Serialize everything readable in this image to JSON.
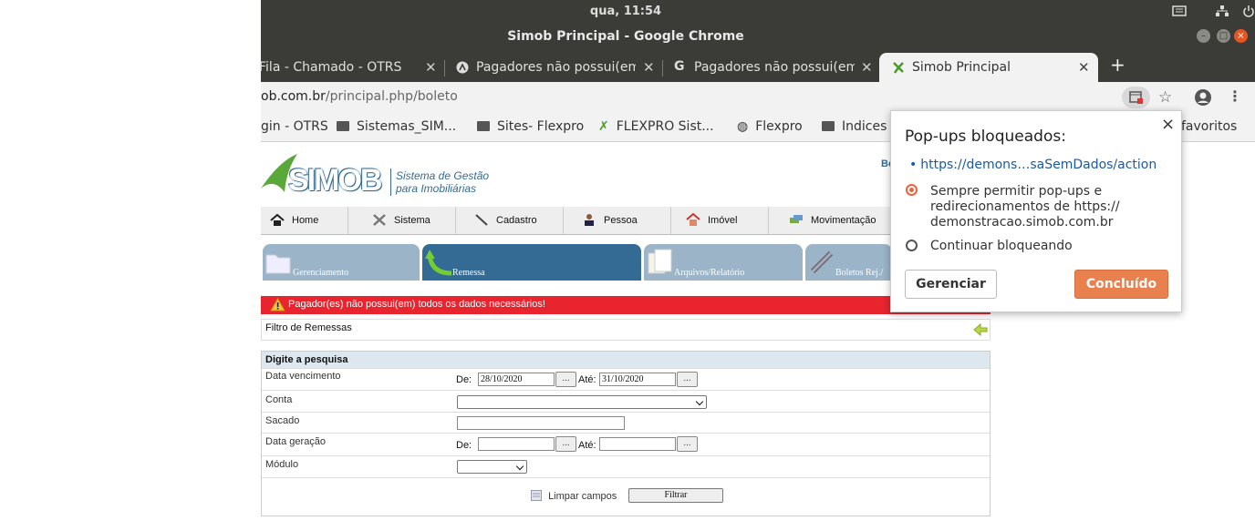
{
  "system": {
    "clock": "qua, 11:54"
  },
  "window": {
    "title": "Simob Principal - Google Chrome"
  },
  "tabs": [
    {
      "label": "Fila - Chamado - OTRS"
    },
    {
      "label": "Pagadores não possui(em"
    },
    {
      "label": "Pagadores não possui(em"
    },
    {
      "label": "Simob Principal"
    }
  ],
  "address": {
    "host": "ob.com.br",
    "path": "/principal.php/boleto"
  },
  "bookmarks": [
    {
      "label": "gin - OTRS"
    },
    {
      "label": "Sistemas_SIM..."
    },
    {
      "label": "Sites- Flexpro"
    },
    {
      "label": "FLEXPRO Sist..."
    },
    {
      "label": "Flexpro"
    },
    {
      "label": "Indices"
    },
    {
      "label": "favoritos"
    }
  ],
  "site": {
    "brand": "SIMOB",
    "tagline1": "Sistema de Gestão",
    "tagline2": "para Imobiliárias",
    "greeting_partial": "Be",
    "menu": [
      "Home",
      "Sistema",
      "Cadastro",
      "Pessoa",
      "Imóvel",
      "Movimentação"
    ],
    "subtabs": [
      "Gerenciamento",
      "Remessa",
      "Arquivos/Relatório",
      "Boletos Rej./"
    ],
    "error": "Pagador(es) não possui(em) todos os dados necessários!",
    "filter_title": "Filtro de Remessas",
    "form": {
      "heading": "Digite a pesquisa",
      "venc_label": "Data vencimento",
      "de": "De:",
      "ate": "Até:",
      "venc_de": "28/10/2020",
      "venc_ate": "31/10/2020",
      "dots": "...",
      "conta_label": "Conta",
      "sacado_label": "Sacado",
      "geracao_label": "Data geração",
      "modulo_label": "Módulo",
      "limpar": "Limpar campos",
      "filtrar": "Filtrar"
    }
  },
  "popup": {
    "title": "Pop-ups bloqueados:",
    "link": "https://demons…saSemDados/action",
    "option_allow": "Sempre permitir pop-ups e redirecionamentos de https://demonstracao.simob.com.br",
    "option_allow_l1": "Sempre permitir pop-ups e",
    "option_allow_l2": "redirecionamentos de https://",
    "option_allow_l3": "demonstracao.simob.com.br",
    "option_block": "Continuar bloqueando",
    "manage": "Gerenciar",
    "done": "Concluído",
    "close": "×"
  },
  "colors": {
    "accent": "#e9643b",
    "site_blue": "#336b94",
    "error_red": "#e8242f"
  }
}
